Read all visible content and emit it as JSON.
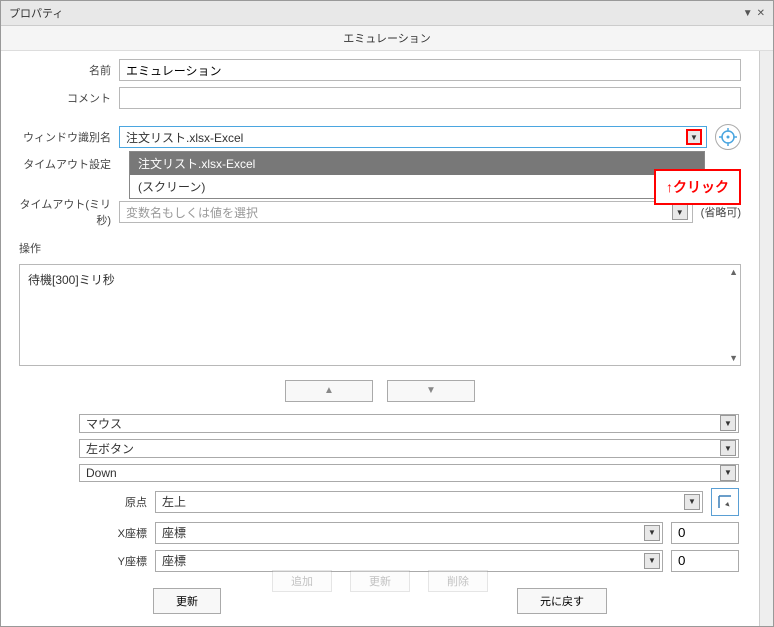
{
  "window": {
    "title": "プロパティ"
  },
  "section": {
    "title": "エミュレーション"
  },
  "labels": {
    "name": "名前",
    "comment": "コメント",
    "windowId": "ウィンドウ識別名",
    "timeoutSetting": "タイムアウト設定",
    "timeoutMs": "タイムアウト(ミリ秒)",
    "operations": "操作",
    "origin": "原点",
    "xCoord": "X座標",
    "yCoord": "Y座標"
  },
  "values": {
    "name": "エミュレーション",
    "comment": "",
    "windowId": "注文リスト.xlsx-Excel",
    "timeoutPlaceholder": "変数名もしくは値を選択",
    "omitOk": "(省略可)",
    "opsText": "待機[300]ミリ秒",
    "mouse": "マウス",
    "leftButton": "左ボタン",
    "down": "Down",
    "origin": "左上",
    "xType": "座標",
    "yType": "座標",
    "xVal": "0",
    "yVal": "0"
  },
  "dropdown": {
    "opt1": "注文リスト.xlsx-Excel",
    "opt2": "(スクリーン)"
  },
  "callout": {
    "text": "↑クリック"
  },
  "buttons": {
    "update": "更新",
    "revert": "元に戻す",
    "add": "追加",
    "refresh": "更新",
    "delete": "削除"
  }
}
